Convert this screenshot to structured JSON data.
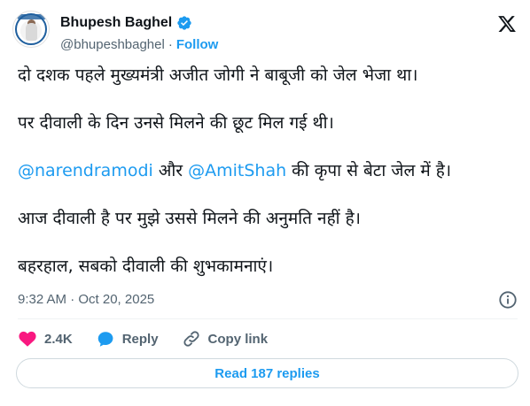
{
  "author": {
    "name": "Bhupesh Baghel",
    "handle": "@bhupeshbaghel",
    "separator": "·",
    "follow_label": "Follow",
    "verified_color": "#1d9bf0"
  },
  "tweet": {
    "line1": "दो दशक पहले मुख्यमंत्री अजीत जोगी ने बाबूजी को जेल भेजा था।",
    "line2": "पर दीवाली के दिन उनसे मिलने की छूट मिल गई थी।",
    "line3_mention1": "@narendramodi",
    "line3_mid": " और ",
    "line3_mention2": "@AmitShah",
    "line3_end": " की कृपा से बेटा जेल में है।",
    "line4": "आज दीवाली है पर मुझे उससे मिलने की अनुमति नहीं है।",
    "line5": "बहरहाल, सबको दीवाली की शुभकामनाएं।"
  },
  "meta": {
    "timestamp": "9:32 AM · Oct 20, 2025"
  },
  "actions": {
    "likes": "2.4K",
    "reply_label": "Reply",
    "copy_link_label": "Copy link",
    "like_color": "#f91880",
    "reply_color": "#1d9bf0"
  },
  "footer": {
    "read_replies_label": "Read 187 replies"
  },
  "icons": {
    "brand": "x-logo-icon",
    "info": "info-icon"
  },
  "colors": {
    "accent": "#1d9bf0",
    "text": "#0f1419",
    "muted": "#536471"
  }
}
